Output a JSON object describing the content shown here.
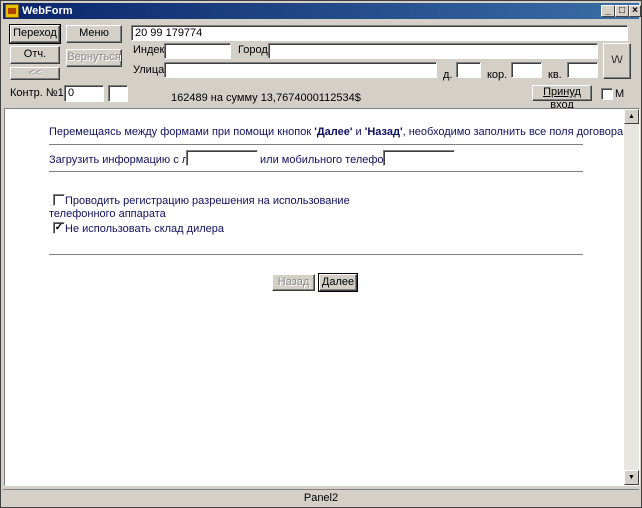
{
  "window": {
    "title": "WebForm"
  },
  "titlebar": {
    "minimize": "_",
    "maximize": "□",
    "close": "×"
  },
  "toolbar": {
    "transition_label": "Переход",
    "menu_label": "Меню",
    "report_label": "Отч.",
    "return_label": "Вернуться",
    "back_label": "<<",
    "wave_label": "\\/\\/",
    "accept_label": "Принуд вход",
    "m_label": "M"
  },
  "address": {
    "top_value": "20 99 179774",
    "index_label": "Индекс",
    "index_value": "",
    "city_label": "Город",
    "city_value": "",
    "street_label": "Улица",
    "street_value": "",
    "house_label": "д.",
    "house_value": "",
    "building_label": "кор.",
    "building_value": "",
    "apt_label": "кв.",
    "apt_value": ""
  },
  "contract": {
    "label": "Контр. №16",
    "value": "0",
    "extra_value": "",
    "balance_text": "162489 на сумму 13,7674000112534$"
  },
  "content": {
    "instruction_prefix": "Перемещаясь между формами при помощи кнопок ",
    "next_quoted": "'Далее'",
    "and_word": " и ",
    "back_quoted": "'Назад'",
    "instruction_suffix": ", необходимо заполнить все поля договора",
    "load_label": "Загрузить информацию с л/с",
    "load_value": "",
    "or_phone_label": "или мобильного телефона",
    "phone_value": "",
    "register_label_line1": "Проводить регистрацию разрешения на использование",
    "register_label_line2": "телефонного аппарата",
    "register_checked": false,
    "no_dealer_label": "Не использовать склад дилера",
    "no_dealer_checked": true,
    "back_button": "Назад",
    "next_button": "Далее"
  },
  "scrollbar": {
    "up": "▲",
    "down": "▼"
  },
  "status": {
    "panel": "Panel2"
  }
}
